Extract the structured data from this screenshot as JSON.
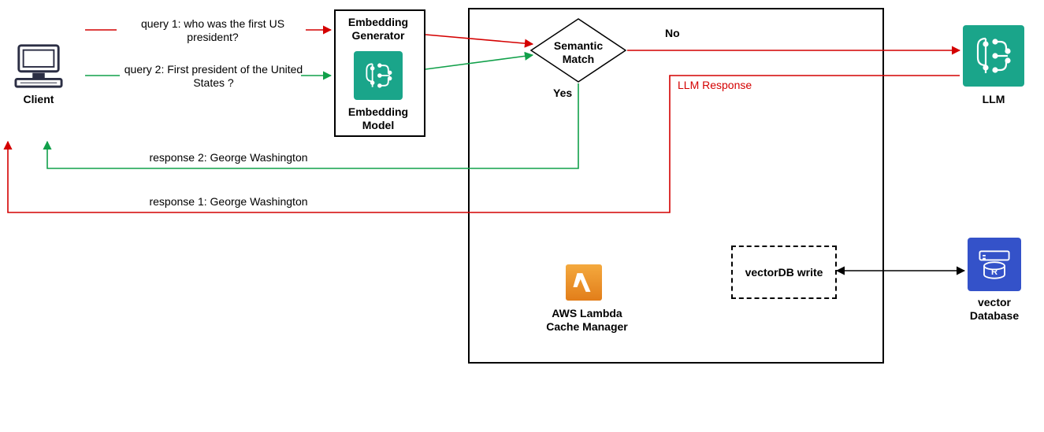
{
  "client": {
    "label": "Client"
  },
  "queries": {
    "q1": "query 1: who was the first US president?",
    "q2": "query 2: First president of the United States ?"
  },
  "responses": {
    "r1": "response 1: George Washington",
    "r2": "response 2: George Washington"
  },
  "embedding": {
    "title": "Embedding Generator",
    "model_label": "Embedding Model"
  },
  "semantic_match": {
    "title": "Semantic Match",
    "yes": "Yes",
    "no": "No"
  },
  "llm": {
    "label": "LLM",
    "response_label": "LLM Response"
  },
  "lambda": {
    "label": "AWS Lambda Cache Manager"
  },
  "vectordb_write": {
    "label": "vectorDB write"
  },
  "vectordb": {
    "label": "vector Database"
  },
  "colors": {
    "query1": "#d40000",
    "query2": "#11a04a",
    "teal": "#1aa58a",
    "lambda": "#e8891d",
    "blue": "#3452c9"
  },
  "chart_data": {
    "type": "diagram",
    "nodes": [
      {
        "id": "client",
        "label": "Client"
      },
      {
        "id": "embedding_generator",
        "label": "Embedding Generator",
        "sublabel": "Embedding Model"
      },
      {
        "id": "semantic_match",
        "label": "Semantic Match",
        "type": "decision",
        "outcomes": [
          "Yes",
          "No"
        ]
      },
      {
        "id": "aws_lambda_cache_manager",
        "label": "AWS Lambda Cache Manager",
        "container_for": [
          "semantic_match",
          "vectordb_write"
        ]
      },
      {
        "id": "llm",
        "label": "LLM"
      },
      {
        "id": "vectordb_write",
        "label": "vectorDB write"
      },
      {
        "id": "vector_database",
        "label": "vector Database"
      }
    ],
    "edges": [
      {
        "from": "client",
        "to": "embedding_generator",
        "label": "query 1: who was the first US president?",
        "path": "query1",
        "color": "#d40000"
      },
      {
        "from": "client",
        "to": "embedding_generator",
        "label": "query 2: First president of the United States ?",
        "path": "query2",
        "color": "#11a04a"
      },
      {
        "from": "embedding_generator",
        "to": "semantic_match",
        "path": "query1",
        "color": "#d40000"
      },
      {
        "from": "embedding_generator",
        "to": "semantic_match",
        "path": "query2",
        "color": "#11a04a"
      },
      {
        "from": "semantic_match",
        "to": "llm",
        "label": "No",
        "path": "query1",
        "color": "#d40000"
      },
      {
        "from": "llm",
        "to": "aws_lambda_cache_manager",
        "label": "LLM Response",
        "path": "query1",
        "color": "#d40000"
      },
      {
        "from": "aws_lambda_cache_manager",
        "to": "client",
        "label": "response 1: George Washington",
        "path": "query1",
        "color": "#d40000"
      },
      {
        "from": "semantic_match",
        "to": "client",
        "label": "response 2: George Washington",
        "via": "Yes",
        "path": "query2",
        "color": "#11a04a"
      },
      {
        "from": "vectordb_write",
        "to": "vector_database",
        "bidirectional": true,
        "color": "#000000"
      }
    ]
  }
}
